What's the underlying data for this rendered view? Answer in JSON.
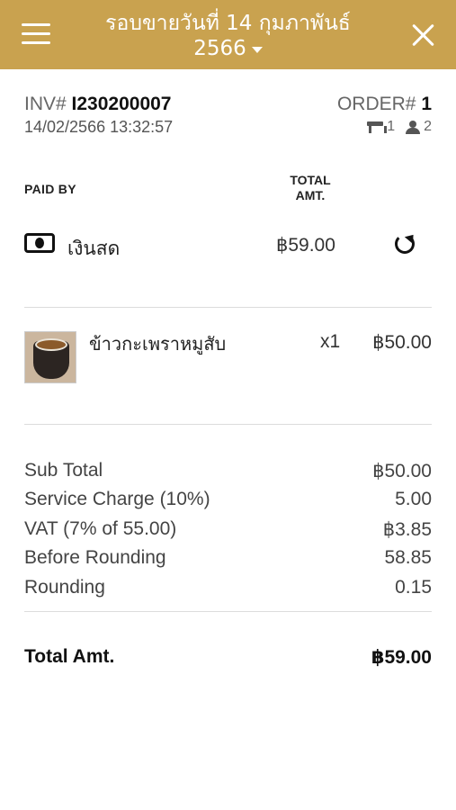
{
  "header": {
    "title_line1": "รอบขายวันที่ 14 กุมภาพันธ์",
    "title_line2": "2566",
    "menu_icon": "hamburger-icon",
    "close_icon": "close-icon",
    "background_color": "#c9a24f"
  },
  "invoice": {
    "inv_prefix": "INV#",
    "inv_number": "I230200007",
    "datetime": "14/02/2566 13:32:57",
    "order_prefix": "ORDER#",
    "order_number": "1",
    "table_count": "1",
    "guest_count": "2"
  },
  "payment": {
    "paid_by_header": "PAID BY",
    "total_header_line1": "TOTAL",
    "total_header_line2": "AMT.",
    "method_icon": "cash-icon",
    "method": "เงินสด",
    "amount": "฿59.00",
    "refresh_icon": "refresh-icon"
  },
  "items": [
    {
      "name": "ข้าวกะเพราหมูสับ",
      "qty": "x1",
      "price": "฿50.00"
    }
  ],
  "summary": [
    {
      "label": "Sub Total",
      "value": "฿50.00"
    },
    {
      "label": "Service Charge (10%)",
      "value": "5.00"
    },
    {
      "label": "VAT (7% of 55.00)",
      "value": "฿3.85"
    },
    {
      "label": "Before Rounding",
      "value": "58.85"
    },
    {
      "label": "Rounding",
      "value": "0.15"
    }
  ],
  "total": {
    "label": "Total Amt.",
    "value": "฿59.00"
  }
}
